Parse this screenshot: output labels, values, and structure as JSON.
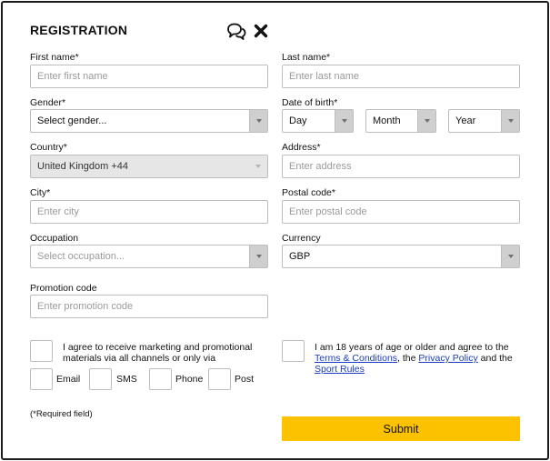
{
  "form": {
    "title": "REGISTRATION",
    "icons": {
      "chat": "chat-bubbles-icon",
      "close": "close-icon"
    }
  },
  "fields": {
    "first_name": {
      "label": "First name*",
      "placeholder": "Enter first name"
    },
    "last_name": {
      "label": "Last name*",
      "placeholder": "Enter last name"
    },
    "gender": {
      "label": "Gender*",
      "value": "Select gender..."
    },
    "dob": {
      "label": "Date of birth*",
      "day": "Day",
      "month": "Month",
      "year": "Year"
    },
    "country": {
      "label": "Country*",
      "value": "United Kingdom +44"
    },
    "address": {
      "label": "Address*",
      "placeholder": "Enter address"
    },
    "city": {
      "label": "City*",
      "placeholder": "Enter city"
    },
    "postal_code": {
      "label": "Postal code*",
      "placeholder": "Enter postal code"
    },
    "occupation": {
      "label": "Occupation",
      "value": "Select occupation..."
    },
    "currency": {
      "label": "Currency",
      "value": "GBP"
    },
    "promo": {
      "label": "Promotion code",
      "placeholder": "Enter promotion code"
    }
  },
  "marketing": {
    "line1": "I agree to receive marketing and promotional",
    "line2": "materials via all channels or only via",
    "channels": {
      "email": "Email",
      "sms": "SMS",
      "phone": "Phone",
      "post": "Post"
    }
  },
  "age": {
    "line1": "I am 18 years of age or older and agree to the",
    "terms": "Terms & Conditions",
    "sep1": ", the ",
    "privacy": "Privacy Policy",
    "sep2": " and the",
    "sport": "Sport Rules"
  },
  "footer": {
    "required_note": "(*Required field)",
    "submit": "Submit"
  },
  "colors": {
    "accent": "#fcc200",
    "link": "#1a3bbd",
    "border": "#bdbdbd",
    "disabled_bg": "#e6e6e6"
  }
}
